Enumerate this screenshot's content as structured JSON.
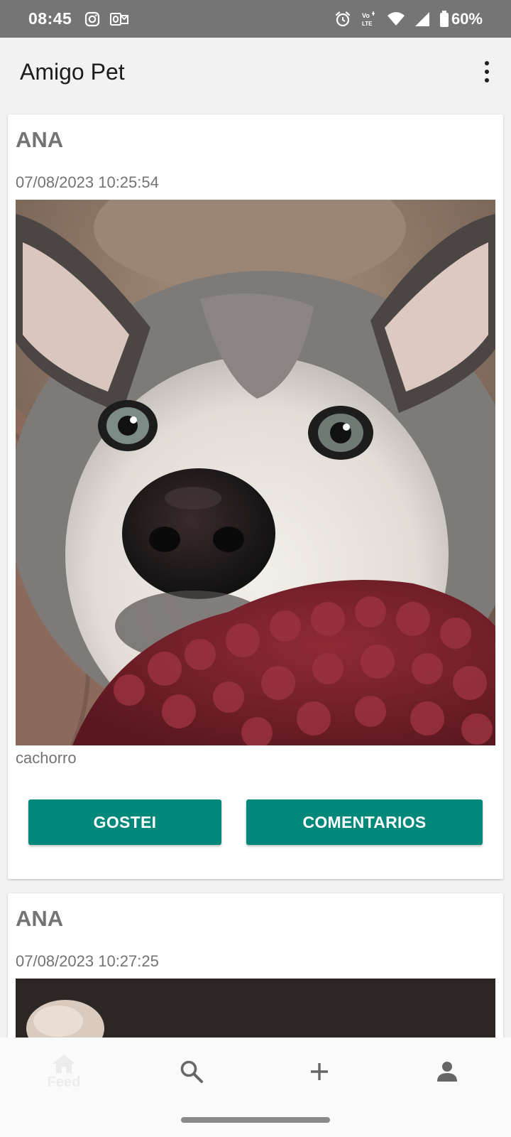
{
  "status_bar": {
    "time": "08:45",
    "battery": "60%",
    "network": "LTE",
    "left_icons": [
      "instagram-icon",
      "outlook-icon"
    ],
    "right_icons": [
      "alarm-icon",
      "volte-icon",
      "wifi-icon",
      "cellular-signal-icon",
      "battery-icon"
    ]
  },
  "app_bar": {
    "title": "Amigo Pet",
    "menu_icon": "more-vert-icon"
  },
  "posts": [
    {
      "user": "ANA",
      "timestamp": "07/08/2023 10:25:54",
      "photo": "husky-dog-photo",
      "caption": "cachorro",
      "like_label": "GOSTEI",
      "comments_label": "COMENTARIOS"
    },
    {
      "user": "ANA",
      "timestamp": "07/08/2023 10:27:25",
      "photo": "pet-photo"
    }
  ],
  "bottom_nav": {
    "items": [
      {
        "label": "Feed",
        "icon": "home-icon",
        "active": true
      },
      {
        "label": "",
        "icon": "search-icon"
      },
      {
        "label": "",
        "icon": "add-icon"
      },
      {
        "label": "",
        "icon": "person-icon"
      }
    ]
  },
  "colors": {
    "accent": "#00897b",
    "status_bar": "#757575",
    "app_bar": "#f2f2f2",
    "secondary_text": "#737373"
  }
}
